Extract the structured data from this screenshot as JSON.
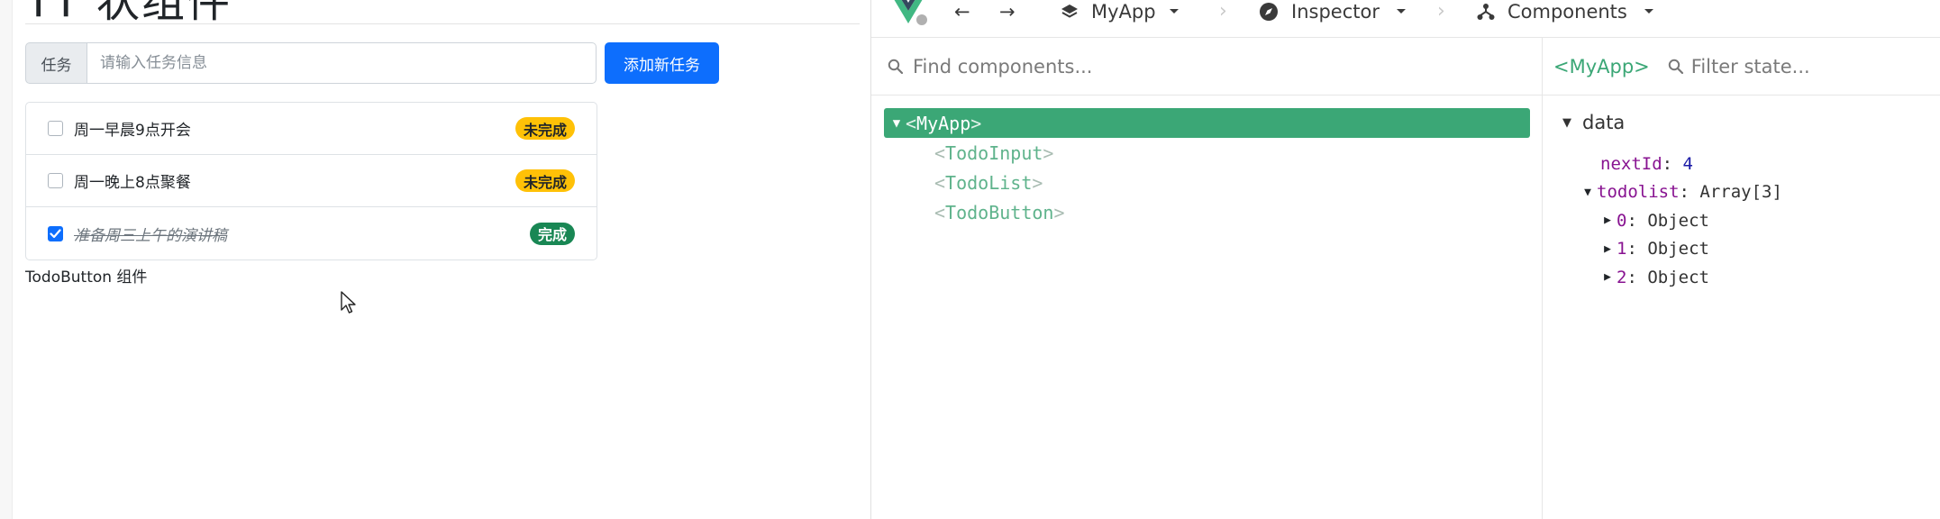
{
  "app": {
    "heading": "TT 状组件",
    "input_prefix": "任务",
    "input_placeholder": "请输入任务信息",
    "add_button_label": "添加新任务",
    "todos": [
      {
        "text": "周一早晨9点开会",
        "checked": false,
        "status": "未完成"
      },
      {
        "text": "周一晚上8点聚餐",
        "checked": false,
        "status": "未完成"
      },
      {
        "text": "准备周三上午的演讲稿",
        "checked": true,
        "status": "完成"
      }
    ],
    "footer_label": "TodoButton 组件"
  },
  "devtools": {
    "toolbar": {
      "app_name": "MyApp",
      "inspector_label": "Inspector",
      "components_label": "Components"
    },
    "components_search_placeholder": "Find components...",
    "tree": {
      "root": "MyApp",
      "children": [
        "TodoInput",
        "TodoList",
        "TodoButton"
      ]
    },
    "state": {
      "selected_tag": "<MyApp>",
      "filter_placeholder": "Filter state...",
      "section": "data",
      "nextId_key": "nextId",
      "nextId_value": "4",
      "todolist_key": "todolist",
      "todolist_value": "Array[3]",
      "items": [
        {
          "index": "0",
          "type": "Object"
        },
        {
          "index": "1",
          "type": "Object"
        },
        {
          "index": "2",
          "type": "Object"
        }
      ]
    }
  },
  "colors": {
    "primary": "#0d6efd",
    "warning": "#ffc107",
    "success": "#198754",
    "vue_green": "#3ba776"
  }
}
